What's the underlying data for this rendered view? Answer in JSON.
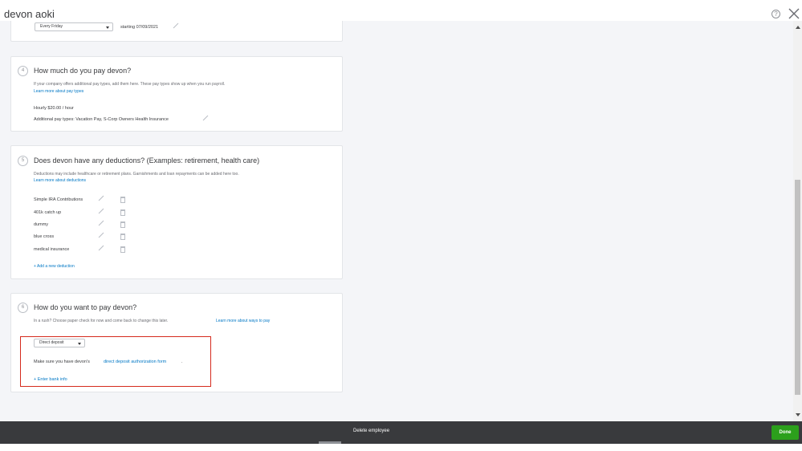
{
  "window": {
    "title": "devon aoki"
  },
  "pay_schedule": {
    "frequency": "Every Friday",
    "starting": "starting 07/09/2021"
  },
  "step4": {
    "num": "4",
    "heading": "How much do you pay devon?",
    "desc": "If your company offers additional pay types, add them here. These pay types show up when you run payroll.",
    "link": "Learn more about pay types",
    "rate": "Hourly $20.00 / hour",
    "additional": "Additional pay types: Vacation Pay, S-Corp Owners Health Insurance"
  },
  "step5": {
    "num": "5",
    "heading": "Does devon have any deductions? (Examples: retirement, health care)",
    "desc": "Deductions may include healthcare or retirement plans. Garnishments and loan repayments can be added here too.",
    "link": "Learn more about deductions",
    "deductions": [
      "Simple IRA Contributions",
      "401k catch up",
      "dummy",
      "blue cross",
      "medical insurance"
    ],
    "add_link": "+ Add a new deduction"
  },
  "step6": {
    "num": "6",
    "heading": "How do you want to pay devon?",
    "desc": "In a rush? Choose paper check for now and come back to change this later.",
    "link": "Learn more about ways to pay",
    "method": "Direct deposit",
    "note_prefix": "Make sure you have devon's",
    "note_link": "direct deposit authorization form",
    "note_suffix": ".",
    "bank_link": "+ Enter bank info"
  },
  "footer": {
    "delete_label": "Delete employee",
    "done_label": "Done"
  },
  "icons": {
    "help": "help-icon",
    "close": "close-icon",
    "edit": "pencil-icon",
    "delete": "trash-icon"
  },
  "colors": {
    "link": "#0077c5",
    "done": "#2ca01c",
    "footer": "#393a3d",
    "highlight": "#d52b1e"
  }
}
